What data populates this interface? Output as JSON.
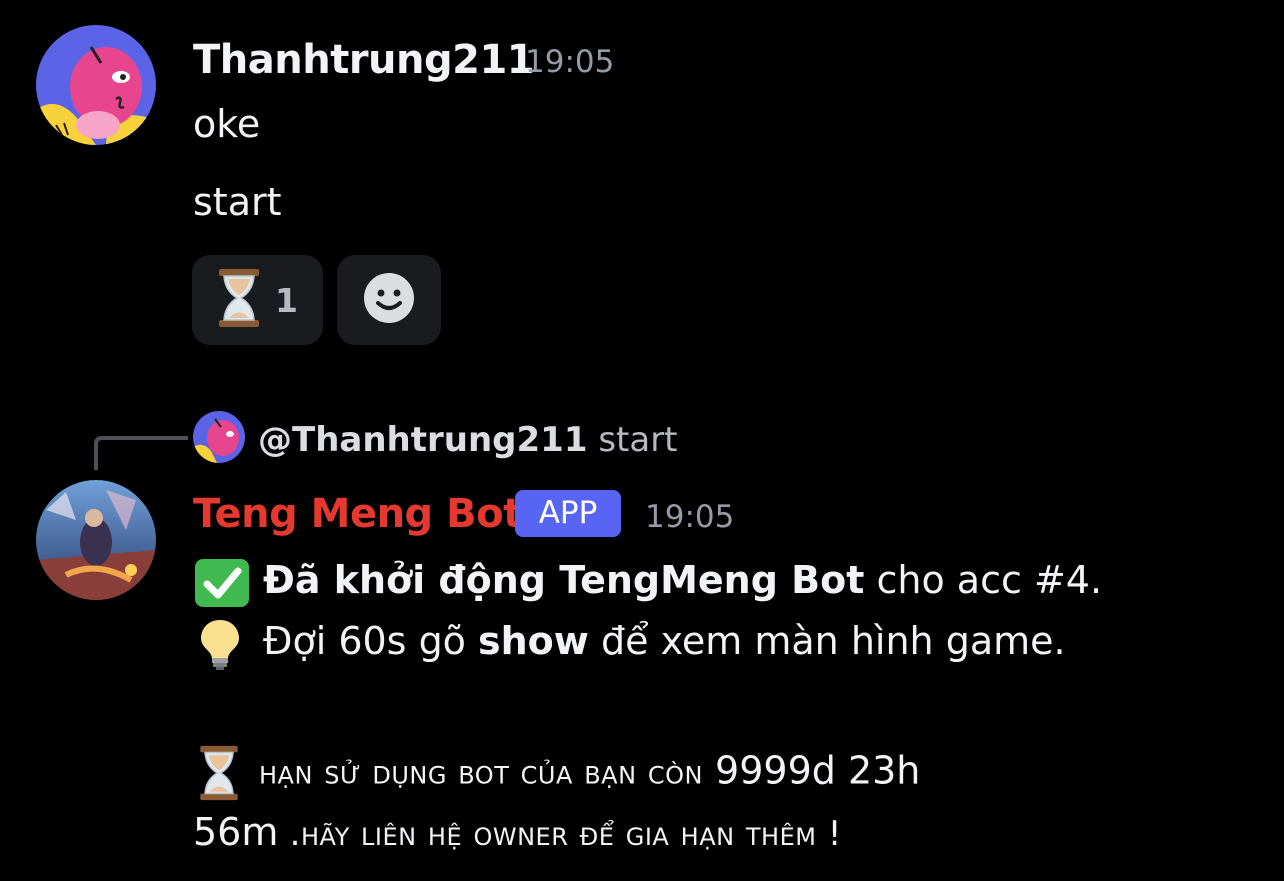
{
  "messages": [
    {
      "author": "Thanhtrung211",
      "timestamp": "19:05",
      "lines": [
        "oke",
        "start"
      ],
      "reactions": [
        {
          "emoji": "hourglass",
          "count": "1"
        },
        {
          "emoji": "add-reaction-smiley"
        }
      ]
    },
    {
      "reply_to": {
        "mention": "@Thanhtrung211",
        "snippet": "start"
      },
      "author": "Teng Meng Bot",
      "author_color": "#e5392f",
      "badge": "APP",
      "timestamp": "19:05",
      "line1": {
        "emoji": "white-check-mark",
        "bold": "Đã khởi động TengMeng Bot",
        "rest": " cho acc #4."
      },
      "line2": {
        "emoji": "light-bulb",
        "pre": "Đợi 60s gõ ",
        "bold": "show",
        "post": " để xem màn hình game."
      },
      "line3": {
        "emoji": "hourglass",
        "sc1": "hạn sử dụng bot của bạn còn",
        "num1": " 9999d 23h"
      },
      "line4": {
        "num2": "56m",
        "sc2": " .hãy liên hệ owner để gia hạn thêm !"
      }
    }
  ],
  "colors": {
    "background": "#000000",
    "text": "#f2f3f5",
    "muted": "#949ba4",
    "bot_name": "#e5392f",
    "badge": "#5865f2"
  }
}
